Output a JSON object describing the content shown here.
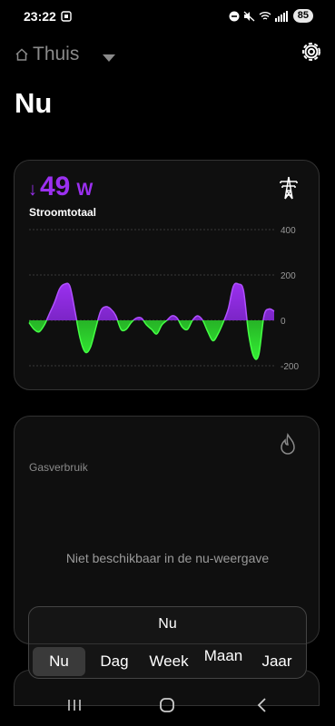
{
  "status_bar": {
    "time": "23:22",
    "battery": "85"
  },
  "header": {
    "title": "Thuis"
  },
  "page_title": "Nu",
  "power_card": {
    "value": "49",
    "unit": "W",
    "direction": "down",
    "label": "Stroomtotaal",
    "colors": {
      "value": "#9b30f0",
      "consumption": "#8a2be2",
      "production": "#22dd22"
    },
    "chart_data": {
      "type": "area",
      "y_ticks": [
        "400",
        "200",
        "0",
        "-200"
      ],
      "ylim": [
        -200,
        400
      ],
      "grid": true,
      "values": [
        -10,
        -40,
        -50,
        -20,
        30,
        80,
        140,
        160,
        150,
        40,
        -80,
        -140,
        -120,
        -40,
        40,
        60,
        50,
        20,
        -40,
        -40,
        -10,
        10,
        10,
        -20,
        -40,
        -60,
        -20,
        0,
        20,
        10,
        -30,
        -40,
        0,
        20,
        0,
        -50,
        -90,
        -60,
        -10,
        50,
        150,
        160,
        130,
        -60,
        -160,
        -150,
        20,
        50,
        40
      ]
    }
  },
  "gas_card": {
    "label": "Gasverbruik",
    "message": "Niet beschikbaar in de nu-weergave"
  },
  "period": {
    "current": "Nu",
    "tabs": [
      {
        "label": "Nu",
        "active": true
      },
      {
        "label": "Dag",
        "active": false
      },
      {
        "label": "Week",
        "active": false
      },
      {
        "label": "Maan",
        "active": false
      },
      {
        "label": "Jaar",
        "active": false
      }
    ]
  }
}
